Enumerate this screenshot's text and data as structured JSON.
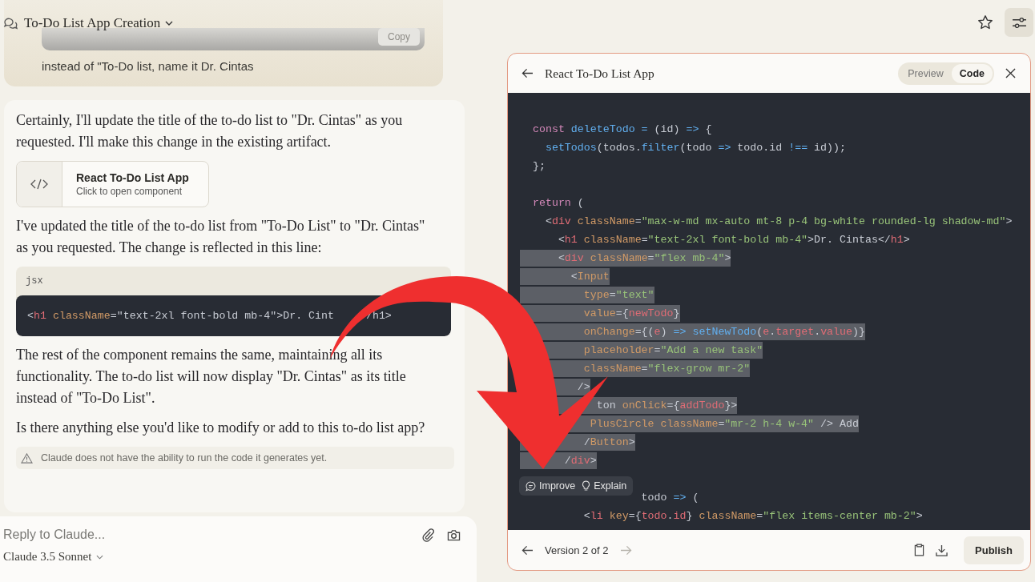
{
  "header": {
    "title": "To-Do List App Creation"
  },
  "user_message": {
    "copy_button": "Copy",
    "text": "instead of \"To-Do list, name it Dr. Cintas"
  },
  "assistant_blocks": [
    {
      "kind": "paragraph",
      "text": "Certainly, I'll update the title of the to-do list to \"Dr. Cintas\" as you requested. I'll make this change in the existing artifact."
    },
    {
      "kind": "artifact",
      "title": "React To-Do List App",
      "subtitle": "Click to open component"
    },
    {
      "kind": "paragraph",
      "text": "I've updated the title of the to-do list from \"To-Do List\" to \"Dr. Cintas\" as you requested. The change is reflected in this line:"
    },
    {
      "kind": "code",
      "language": "jsx",
      "tokens": [
        {
          "kind": "plain",
          "text": "<"
        },
        {
          "kind": "tag",
          "text": "h1"
        },
        {
          "kind": "attr",
          "text": " className"
        },
        {
          "kind": "plain",
          "text": "=\"text-2xl font-bold mb-4\">Dr. Cint     /h1>"
        }
      ]
    },
    {
      "kind": "paragraph",
      "text": "The rest of the component remains the same, maintaining all its functionality. The to-do list will now display \"Dr. Cintas\" as its title instead of \"To-Do List\"."
    },
    {
      "kind": "paragraph",
      "text": "Is there anything else you'd like to modify or add to this to-do list app?"
    },
    {
      "kind": "note",
      "text": "Claude does not have the ability to run the code it generates yet."
    }
  ],
  "composer": {
    "placeholder": "Reply to Claude...",
    "model": "Claude 3.5 Sonnet"
  },
  "artifact_panel": {
    "title": "React To-Do List App",
    "tabs": [
      {
        "label": "Preview",
        "selected": false
      },
      {
        "label": "Code",
        "selected": true
      }
    ],
    "code_lines": [
      {
        "kind": "code",
        "selected": false,
        "tokens": [
          {
            "kind": "kw",
            "text": "  const"
          },
          {
            "kind": "fn",
            "text": " deleteTodo"
          },
          {
            "kind": "op",
            "text": " ="
          },
          {
            "kind": "plain",
            "text": " (id)"
          },
          {
            "kind": "op",
            "text": " =>"
          },
          {
            "kind": "plain",
            "text": " {"
          }
        ]
      },
      {
        "kind": "code",
        "selected": false,
        "tokens": [
          {
            "kind": "fn",
            "text": "    setTodos"
          },
          {
            "kind": "plain",
            "text": "(todos."
          },
          {
            "kind": "fn",
            "text": "filter"
          },
          {
            "kind": "plain",
            "text": "(todo"
          },
          {
            "kind": "op",
            "text": " =>"
          },
          {
            "kind": "plain",
            "text": " todo.id"
          },
          {
            "kind": "op",
            "text": " !=="
          },
          {
            "kind": "plain",
            "text": " id));"
          }
        ]
      },
      {
        "kind": "code",
        "selected": false,
        "tokens": [
          {
            "kind": "plain",
            "text": "  };"
          }
        ]
      },
      {
        "kind": "blank",
        "selected": false
      },
      {
        "kind": "code",
        "selected": false,
        "tokens": [
          {
            "kind": "kw",
            "text": "  return"
          },
          {
            "kind": "plain",
            "text": " ("
          }
        ]
      },
      {
        "kind": "code",
        "selected": false,
        "tokens": [
          {
            "kind": "plain",
            "text": "    <"
          },
          {
            "kind": "tag",
            "text": "div"
          },
          {
            "kind": "attr",
            "text": " className"
          },
          {
            "kind": "plain",
            "text": "="
          },
          {
            "kind": "str",
            "text": "\"max-w-md mx-auto mt-8 p-4 bg-white rounded-lg shadow-md\""
          },
          {
            "kind": "plain",
            "text": ">"
          }
        ]
      },
      {
        "kind": "code",
        "selected": false,
        "tokens": [
          {
            "kind": "plain",
            "text": "      <"
          },
          {
            "kind": "tag",
            "text": "h1"
          },
          {
            "kind": "attr",
            "text": " className"
          },
          {
            "kind": "plain",
            "text": "="
          },
          {
            "kind": "str",
            "text": "\"text-2xl font-bold mb-4\""
          },
          {
            "kind": "plain",
            "text": ">Dr. Cintas</"
          },
          {
            "kind": "tag",
            "text": "h1"
          },
          {
            "kind": "plain",
            "text": ">"
          }
        ]
      },
      {
        "kind": "code",
        "selected": true,
        "tokens": [
          {
            "kind": "plain",
            "text": "      <"
          },
          {
            "kind": "tag",
            "text": "div"
          },
          {
            "kind": "attr",
            "text": " className"
          },
          {
            "kind": "plain",
            "text": "="
          },
          {
            "kind": "str",
            "text": "\"flex mb-4\""
          },
          {
            "kind": "plain",
            "text": ">"
          }
        ]
      },
      {
        "kind": "code",
        "selected": true,
        "tokens": [
          {
            "kind": "plain",
            "text": "        <"
          },
          {
            "kind": "attr",
            "text": "Input"
          }
        ]
      },
      {
        "kind": "code",
        "selected": true,
        "tokens": [
          {
            "kind": "attr",
            "text": "          type"
          },
          {
            "kind": "plain",
            "text": "="
          },
          {
            "kind": "str",
            "text": "\"text\""
          }
        ]
      },
      {
        "kind": "code",
        "selected": true,
        "tokens": [
          {
            "kind": "attr",
            "text": "          value"
          },
          {
            "kind": "plain",
            "text": "={"
          },
          {
            "kind": "tag",
            "text": "newTodo"
          },
          {
            "kind": "plain",
            "text": "}"
          }
        ]
      },
      {
        "kind": "code",
        "selected": true,
        "tokens": [
          {
            "kind": "attr",
            "text": "          onChange"
          },
          {
            "kind": "plain",
            "text": "={("
          },
          {
            "kind": "tag",
            "text": "e"
          },
          {
            "kind": "plain",
            "text": ")"
          },
          {
            "kind": "op",
            "text": " =>"
          },
          {
            "kind": "fn",
            "text": " setNewTodo"
          },
          {
            "kind": "plain",
            "text": "("
          },
          {
            "kind": "tag",
            "text": "e"
          },
          {
            "kind": "plain",
            "text": "."
          },
          {
            "kind": "tag",
            "text": "target"
          },
          {
            "kind": "plain",
            "text": "."
          },
          {
            "kind": "tag",
            "text": "value"
          },
          {
            "kind": "plain",
            "text": ")}"
          }
        ]
      },
      {
        "kind": "code",
        "selected": true,
        "tokens": [
          {
            "kind": "attr",
            "text": "          placeholder"
          },
          {
            "kind": "plain",
            "text": "="
          },
          {
            "kind": "str",
            "text": "\"Add a new task\""
          }
        ]
      },
      {
        "kind": "code",
        "selected": true,
        "tokens": [
          {
            "kind": "attr",
            "text": "          className"
          },
          {
            "kind": "plain",
            "text": "="
          },
          {
            "kind": "str",
            "text": "\"flex-grow mr-2\""
          }
        ]
      },
      {
        "kind": "code",
        "selected": true,
        "tokens": [
          {
            "kind": "plain",
            "text": "         />"
          }
        ]
      },
      {
        "kind": "code",
        "selected": true,
        "tokens": [
          {
            "kind": "plain",
            "text": "            ton"
          },
          {
            "kind": "attr",
            "text": " onClick"
          },
          {
            "kind": "plain",
            "text": "={"
          },
          {
            "kind": "tag",
            "text": "addTodo"
          },
          {
            "kind": "plain",
            "text": "}>"
          }
        ]
      },
      {
        "kind": "code",
        "selected": true,
        "tokens": [
          {
            "kind": "attr",
            "text": "           PlusCircle"
          },
          {
            "kind": "attr",
            "text": " className"
          },
          {
            "kind": "plain",
            "text": "="
          },
          {
            "kind": "str",
            "text": "\"mr-2 h-4 w-4\""
          },
          {
            "kind": "plain",
            "text": " /> Add"
          }
        ]
      },
      {
        "kind": "code",
        "selected": true,
        "tokens": [
          {
            "kind": "plain",
            "text": "          /"
          },
          {
            "kind": "attr",
            "text": "Button"
          },
          {
            "kind": "plain",
            "text": ">"
          }
        ]
      },
      {
        "kind": "code",
        "selected": true,
        "tokens": [
          {
            "kind": "plain",
            "text": "       /"
          },
          {
            "kind": "tag",
            "text": "div"
          },
          {
            "kind": "plain",
            "text": ">"
          }
        ]
      },
      {
        "kind": "blank",
        "selected": false
      },
      {
        "kind": "code",
        "selected": false,
        "tokens": [
          {
            "kind": "plain",
            "text": "                   todo"
          },
          {
            "kind": "op",
            "text": " =>"
          },
          {
            "kind": "plain",
            "text": " ("
          }
        ]
      },
      {
        "kind": "code",
        "selected": false,
        "tokens": [
          {
            "kind": "plain",
            "text": "          <"
          },
          {
            "kind": "tag",
            "text": "li"
          },
          {
            "kind": "attr",
            "text": " key"
          },
          {
            "kind": "plain",
            "text": "={"
          },
          {
            "kind": "tag",
            "text": "todo"
          },
          {
            "kind": "plain",
            "text": "."
          },
          {
            "kind": "tag",
            "text": "id"
          },
          {
            "kind": "plain",
            "text": "}"
          },
          {
            "kind": "attr",
            "text": " className"
          },
          {
            "kind": "plain",
            "text": "="
          },
          {
            "kind": "str",
            "text": "\"flex items-center mb-2\""
          },
          {
            "kind": "plain",
            "text": ">"
          }
        ]
      }
    ],
    "selection_actions": [
      "Improve",
      "Explain"
    ],
    "footer": {
      "version": "Version 2 of 2",
      "next_disabled": true,
      "publish": "Publish"
    }
  }
}
